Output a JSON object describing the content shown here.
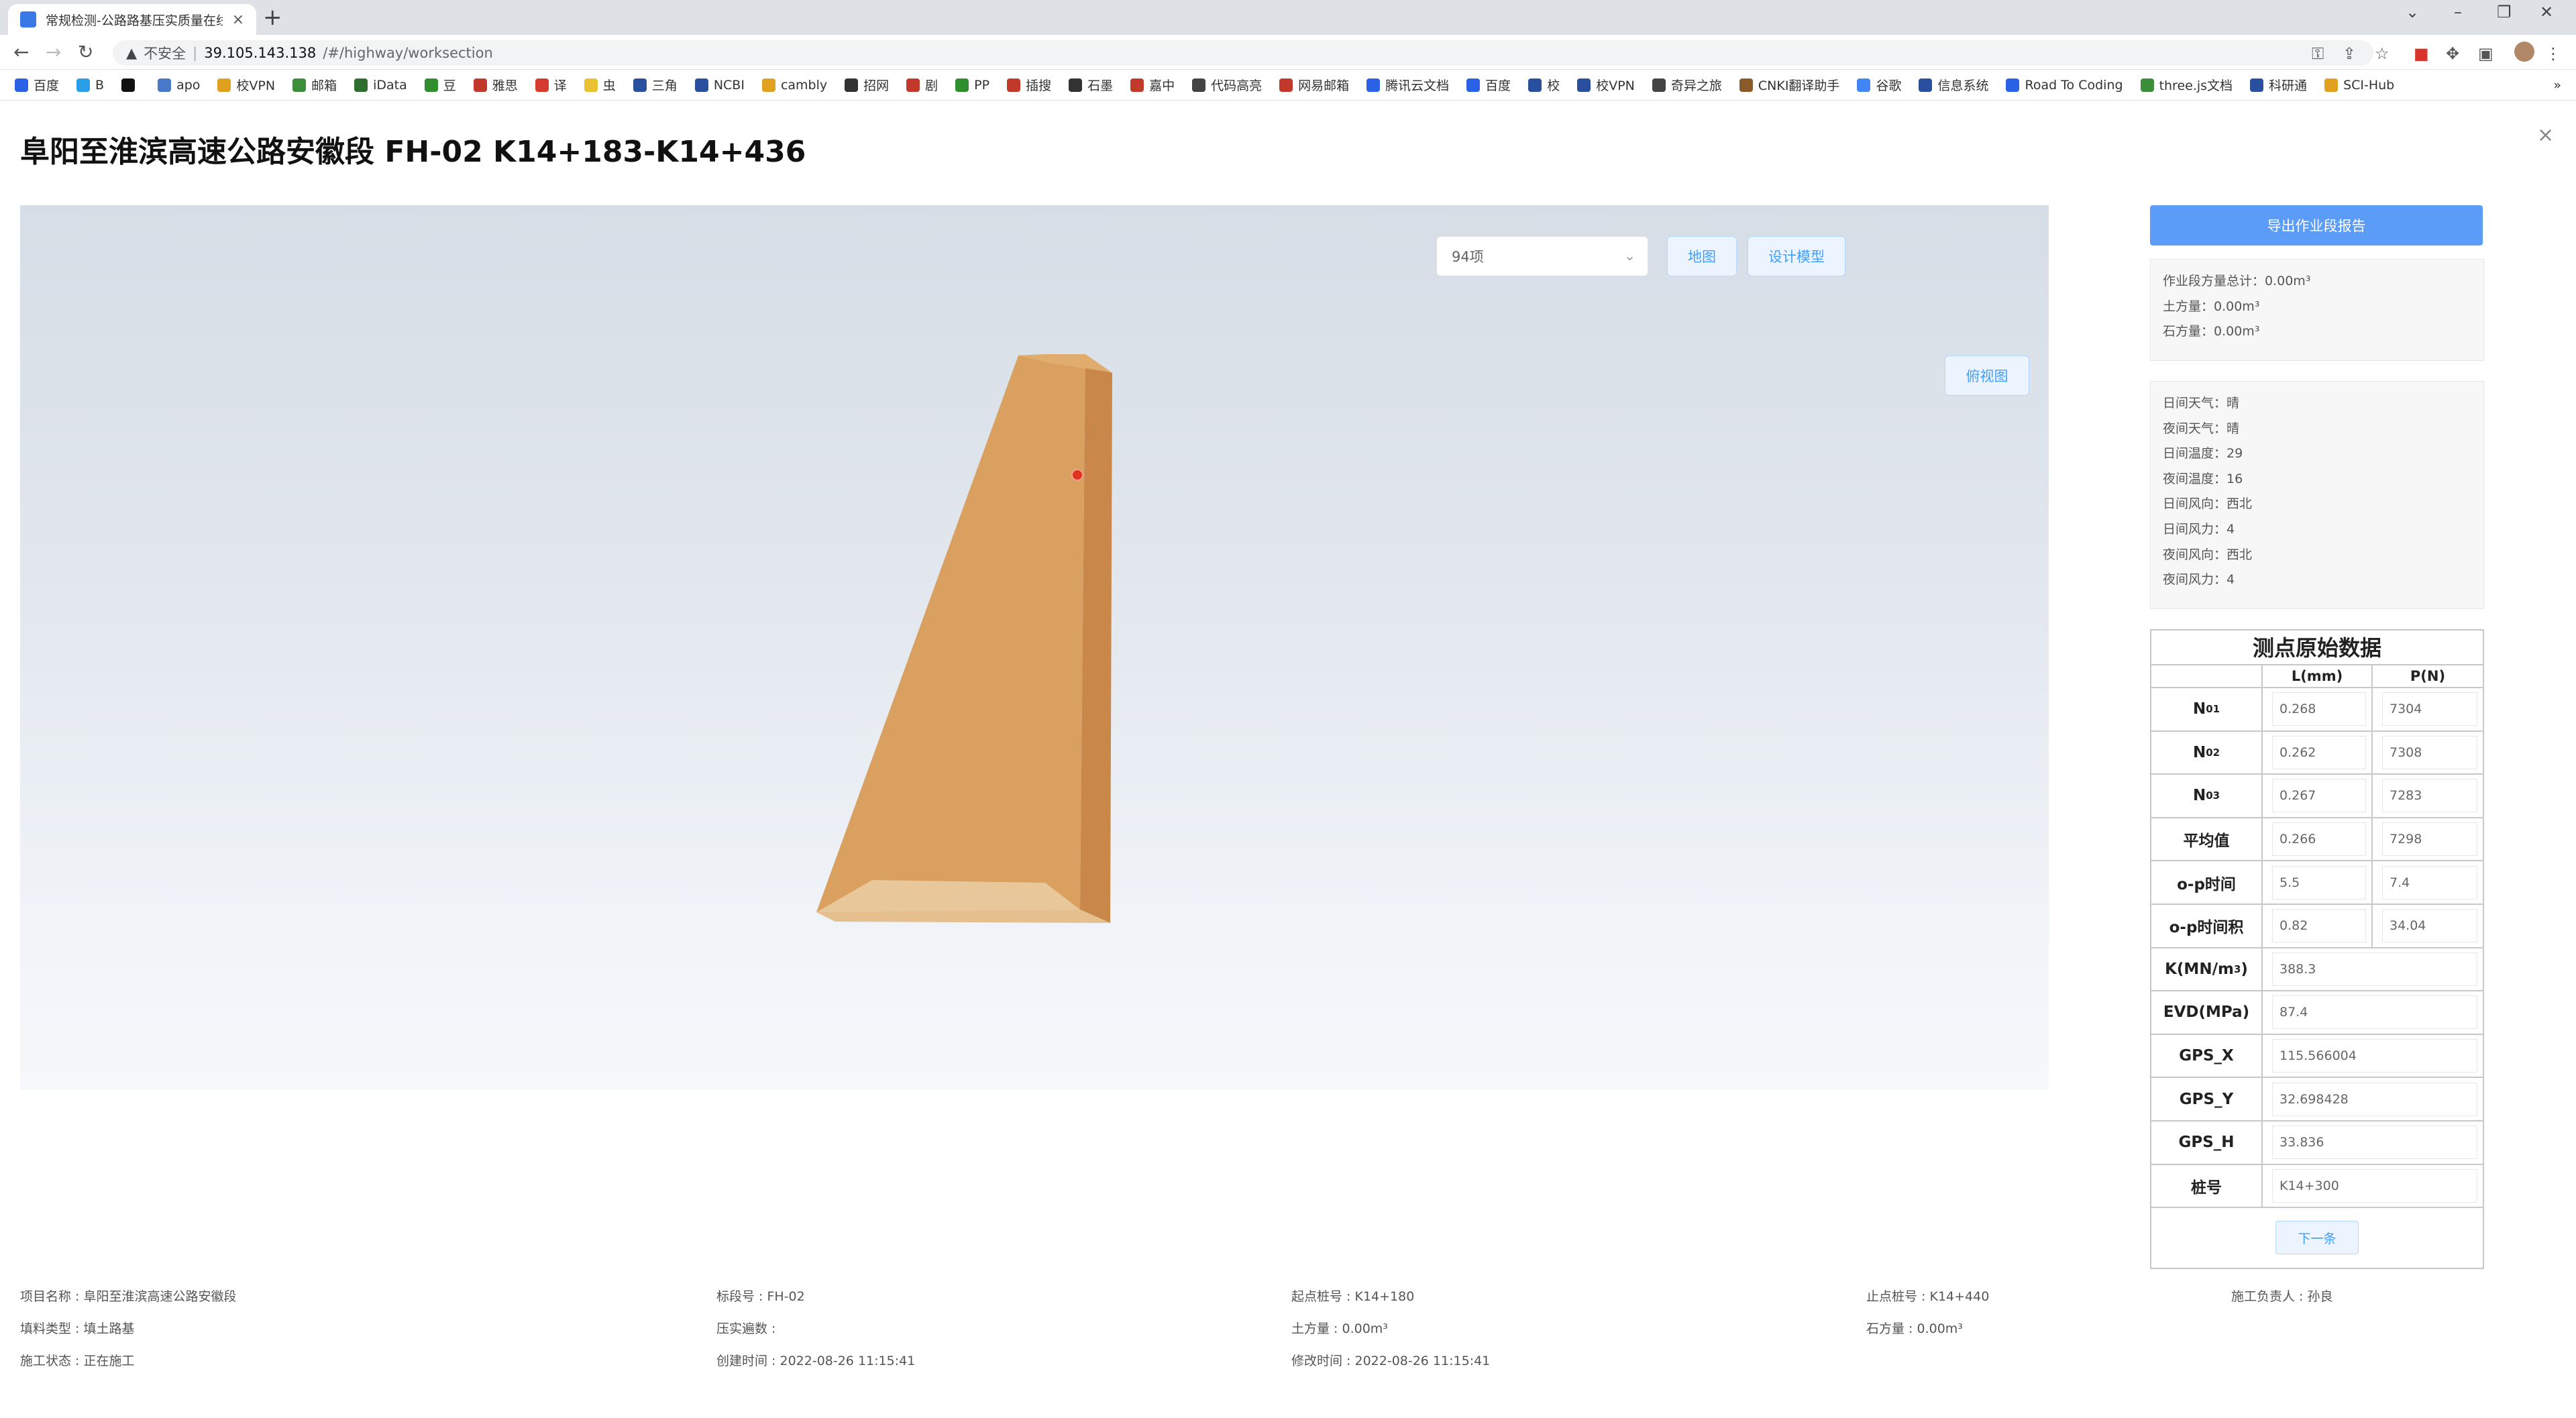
{
  "browser": {
    "tab_title": "常规检测-公路路基压实质量在线",
    "tab_close": "×",
    "new_tab": "+",
    "address": {
      "insecure": "不安全",
      "sep": "|",
      "host": "39.105.143.138",
      "path": "/#/highway/worksection"
    },
    "bookmarks": [
      {
        "label": "百度",
        "color": "#2a62e6"
      },
      {
        "label": "B",
        "color": "#2a9ee6"
      },
      {
        "label": "",
        "color": "#111111"
      },
      {
        "label": "apo",
        "color": "#4a78c9"
      },
      {
        "label": "校VPN",
        "color": "#e0a020"
      },
      {
        "label": "邮箱",
        "color": "#3c8d3c"
      },
      {
        "label": "iData",
        "color": "#2f6e2f"
      },
      {
        "label": "豆",
        "color": "#2f8f2f"
      },
      {
        "label": "雅思",
        "color": "#c0392b"
      },
      {
        "label": "译",
        "color": "#d63b2f"
      },
      {
        "label": "虫",
        "color": "#e8c230"
      },
      {
        "label": "三角",
        "color": "#2a4f9e"
      },
      {
        "label": "NCBI",
        "color": "#2a4f9e"
      },
      {
        "label": "cambly",
        "color": "#e0a020"
      },
      {
        "label": "招网",
        "color": "#333333"
      },
      {
        "label": "剧",
        "color": "#c0392b"
      },
      {
        "label": "PP",
        "color": "#2f8f2f"
      },
      {
        "label": "插搜",
        "color": "#c0392b"
      },
      {
        "label": "石墨",
        "color": "#333333"
      },
      {
        "label": "嘉中",
        "color": "#c0392b"
      },
      {
        "label": "代码高亮",
        "color": "#444444"
      },
      {
        "label": "网易邮箱",
        "color": "#c0392b"
      },
      {
        "label": "腾讯云文档",
        "color": "#2a62e6"
      },
      {
        "label": "百度",
        "color": "#2a62e6"
      },
      {
        "label": "校",
        "color": "#2a4f9e"
      },
      {
        "label": "校VPN",
        "color": "#2a4f9e"
      },
      {
        "label": "奇异之旅",
        "color": "#444444"
      },
      {
        "label": "CNKI翻译助手",
        "color": "#8a5a2a"
      },
      {
        "label": "谷歌",
        "color": "#4285f4"
      },
      {
        "label": "信息系统",
        "color": "#2a4f9e"
      },
      {
        "label": "Road To Coding",
        "color": "#2a62e6"
      },
      {
        "label": "three.js文档",
        "color": "#3c8d3c"
      },
      {
        "label": "科研通",
        "color": "#2a4f9e"
      },
      {
        "label": "SCI-Hub",
        "color": "#e0a020"
      }
    ],
    "bookmarks_more": "»"
  },
  "page": {
    "title": "阜阳至淮滨高速公路安徽段 FH-02 K14+183-K14+436",
    "close": "×"
  },
  "viewer": {
    "select_value": "94项",
    "map_button": "地图",
    "design_model_button": "设计模型",
    "top_view_button": "俯视图",
    "model_color": "#d9a05f"
  },
  "panel": {
    "export_button": "导出作业段报告",
    "volumes": [
      "作业段方量总计：0.00m³",
      "土方量：0.00m³",
      "石方量：0.00m³"
    ],
    "weather": [
      "日间天气：晴",
      "夜间天气：晴",
      "日间温度：29",
      "夜间温度：16",
      "日间风向：西北",
      "日间风力：4",
      "夜间风向：西北",
      "夜间风力：4"
    ],
    "table": {
      "title": "测点原始数据",
      "col_l": "L(mm)",
      "col_p": "P(N)",
      "n01": {
        "label": "N",
        "sub": "01",
        "l": "0.268",
        "p": "7304"
      },
      "n02": {
        "label": "N",
        "sub": "02",
        "l": "0.262",
        "p": "7308"
      },
      "n03": {
        "label": "N",
        "sub": "03",
        "l": "0.267",
        "p": "7283"
      },
      "avg": {
        "label": "平均值",
        "l": "0.266",
        "p": "7298"
      },
      "op_time": {
        "label": "o-p时间",
        "l": "5.5",
        "p": "7.4"
      },
      "op_integral": {
        "label": "o-p时间积",
        "l": "0.82",
        "p": "34.04"
      },
      "k": {
        "label": "K(MN/m",
        "sup": "3",
        "tail": ")",
        "value": "388.3"
      },
      "evd": {
        "label": "EVD(MPa)",
        "value": "87.4"
      },
      "gps_x": {
        "label": "GPS_X",
        "value": "115.566004"
      },
      "gps_y": {
        "label": "GPS_Y",
        "value": "32.698428"
      },
      "gps_h": {
        "label": "GPS_H",
        "value": "33.836"
      },
      "station": {
        "label": "桩号",
        "value": "K14+300"
      },
      "next_button": "下一条"
    }
  },
  "footer": {
    "project_name": "项目名称 : 阜阳至淮滨高速公路安徽段",
    "section_no": "标段号 : FH-02",
    "start_station": "起点桩号 : K14+180",
    "end_station": "止点桩号 : K14+440",
    "manager": "施工负责人 : 孙良",
    "fill_type": "填料类型 : 填土路基",
    "compaction_passes": "压实遍数 :",
    "earth_volume": "土方量 : 0.00m³",
    "stone_volume": "石方量 : 0.00m³",
    "status": "施工状态 : 正在施工",
    "created": "创建时间 : 2022-08-26 11:15:41",
    "modified": "修改时间 : 2022-08-26 11:15:41"
  }
}
